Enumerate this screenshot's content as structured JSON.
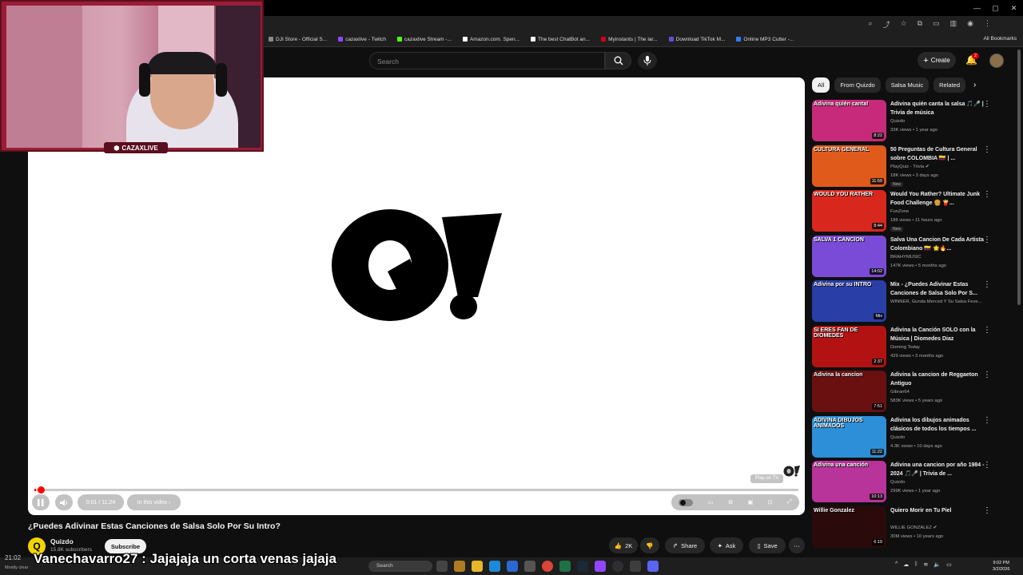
{
  "browser": {
    "bookmarks": [
      {
        "label": "DJI Store - Official S...",
        "color": "#888888"
      },
      {
        "label": "cazaxlive - Twitch",
        "color": "#9146ff"
      },
      {
        "label": "cazaxlive Stream -...",
        "color": "#53fc18"
      },
      {
        "label": "Amazon.com. Spen...",
        "color": "#ffffff"
      },
      {
        "label": "The best ChatBot an...",
        "color": "#ffffff"
      },
      {
        "label": "Myinstants | The lar...",
        "color": "#d0021b"
      },
      {
        "label": "Download TikTok M...",
        "color": "#6c4bd3"
      },
      {
        "label": "Online MP3 Cutter -...",
        "color": "#2d7ff9"
      }
    ],
    "all_bookmarks": "All Bookmarks"
  },
  "header": {
    "search_placeholder": "Search",
    "create_label": "Create",
    "notification_count": "2"
  },
  "webcam": {
    "badge": "CAZAXLIVE"
  },
  "player": {
    "time": "0:01 / 11:24",
    "chapter": "In this video",
    "play_on_tv": "Play on TV",
    "progress_fraction": 0.002
  },
  "video": {
    "title": "¿Puedes Adivinar Estas Canciones de Salsa Solo Por Su Intro?",
    "channel": "Quizdo",
    "subscribers": "15.8K subscribers",
    "subscribe_label": "Subscribe",
    "likes": "2K",
    "share_label": "Share",
    "ask_label": "Ask",
    "save_label": "Save"
  },
  "overlay": {
    "chat_message": "Vanechavarro27 : Jajajaja un corta venas jajaja",
    "cam_time": "21:02",
    "weather": "Mostly clear"
  },
  "taskbar": {
    "search_label": "Search",
    "time": "9:02 PM",
    "date": "3/2/2026"
  },
  "sidebar": {
    "chips": [
      "All",
      "From Quizdo",
      "Salsa Music",
      "Related"
    ],
    "recommendations": [
      {
        "title": "Adivina quién canta la salsa 🎵🎤 | Trivia de música",
        "channel": "Quizdo",
        "meta": "33K views • 1 year ago",
        "duration": "8:22",
        "thumb_text": "Adivina quién canta!",
        "bg": "#c72a7a",
        "new": ""
      },
      {
        "title": "50 Preguntas de Cultura General sobre COLOMBIA 🇨🇴 | ...",
        "channel": "PlayQuiz - Trivia ✔",
        "meta": "18K views • 3 days ago",
        "duration": "11:59",
        "thumb_text": "CULTURA GENERAL",
        "bg": "#e05a1b",
        "new": "New"
      },
      {
        "title": "Would You Rather? Ultimate Junk Food Challenge 🍔 🍟...",
        "channel": "FunZone",
        "meta": "186 views • 11 hours ago",
        "duration": "8:44",
        "thumb_text": "WOULD YOU RATHER",
        "bg": "#d8281e",
        "new": "New"
      },
      {
        "title": "Salva Una Cancion De Cada Artista Colombiano 🇨🇴 🌟🔥...",
        "channel": "BRAHYMUSIC",
        "meta": "147K views • 5 months ago",
        "duration": "14:02",
        "thumb_text": "SALVA 1 CANCION",
        "bg": "#7a4bd6",
        "new": ""
      },
      {
        "title": "Mix - ¿Puedes Adivinar Estas Canciones de Salsa Solo Por S...",
        "channel": "WINNER, Gunda Merced Y Su Salsa Feve...",
        "meta": "",
        "duration": "Mix",
        "thumb_text": "Adivina por su INTRO",
        "bg": "#2a3ea8",
        "new": ""
      },
      {
        "title": "Adivina la Canción SOLO con la Música | Diomedes Diaz",
        "channel": "Doming Today",
        "meta": "429 views • 3 months ago",
        "duration": "2:37",
        "thumb_text": "SI ERES FAN DE DIOMEDES",
        "bg": "#b31212",
        "new": ""
      },
      {
        "title": "Adivina la cancion de Reggaeton Antiguo",
        "channel": "Gibran64",
        "meta": "583K views • 5 years ago",
        "duration": "7:51",
        "thumb_text": "Adivina la cancion",
        "bg": "#6a1010",
        "new": ""
      },
      {
        "title": "Adivina los dibujos animados clásicos de todos los tiempos ...",
        "channel": "Quizdo",
        "meta": "4.3K views • 10 days ago",
        "duration": "11:22",
        "thumb_text": "ADIVINA DIBUJOS ANIMADOS",
        "bg": "#2d8fd8",
        "new": ""
      },
      {
        "title": "Adivina una cancion por año 1984 - 2024 🎵🎤 | Trivia de ...",
        "channel": "Quizdo",
        "meta": "299K views • 1 year ago",
        "duration": "10:13",
        "thumb_text": "Adivina una canción",
        "bg": "#b8339a",
        "new": ""
      },
      {
        "title": "Quiero Morir en Tu Piel",
        "channel": "WILLIE GONZALEZ ✔",
        "meta": "30M views • 10 years ago",
        "duration": "6:19",
        "thumb_text": "Willie Gonzalez",
        "bg": "#2a0a0a",
        "new": ""
      }
    ]
  }
}
